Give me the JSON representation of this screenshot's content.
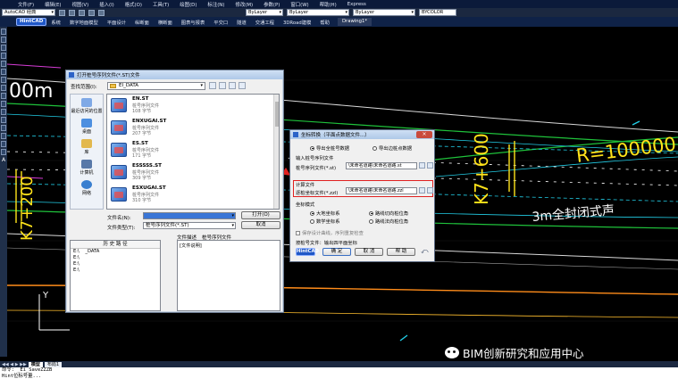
{
  "menubar": [
    "文件(F)",
    "编辑(E)",
    "视图(V)",
    "插入(I)",
    "格式(O)",
    "工具(T)",
    "绘图(D)",
    "标注(N)",
    "修改(M)",
    "参数(P)",
    "窗口(W)",
    "帮助(H)",
    "Express"
  ],
  "workspace": {
    "name": "AutoCAD 经典",
    "layer_label": "ByLayer",
    "linetype_label": "ByLayer",
    "lineweight_label": "ByLayer",
    "plotstyle_label": "BYCOLOR"
  },
  "ribbon": {
    "logo": "HintCAD",
    "items": [
      "系统",
      "数字地面模型",
      "平面设计",
      "纵断面",
      "横断面",
      "图表与报表",
      "平交口",
      "隧道",
      "交通工程",
      "3DRoad建模",
      "帮助"
    ],
    "doc_tab": "Drawing1*"
  },
  "canvas": {
    "labels": {
      "station_left": "K7+200",
      "station_mid": "K7+600",
      "radius": "R=100000",
      "noise_barrier": "3m全封闭式声",
      "partial_left": "00m",
      "ucs_y": "Y"
    }
  },
  "file_dialog": {
    "title": "打开桩号序列文件(*.ST)文件",
    "look_in_label": "查找范围(I):",
    "look_in_value": "EI_DATA",
    "places": [
      "最近访问的位置",
      "桌面",
      "库",
      "计算机",
      "网络"
    ],
    "files": [
      {
        "name": "EN.ST",
        "type": "桩号序列文件",
        "size": "108 字节"
      },
      {
        "name": "ENXUGAI.ST",
        "type": "桩号序列文件",
        "size": "207 字节"
      },
      {
        "name": "ES.ST",
        "type": "桩号序列文件",
        "size": "171 字节"
      },
      {
        "name": "ESSSSS.ST",
        "type": "桩号序列文件",
        "size": "309 字节"
      },
      {
        "name": "ESXUGAI.ST",
        "type": "桩号序列文件",
        "size": "310 字节"
      }
    ],
    "filename_label": "文件名(N):",
    "filename_value": "",
    "filetype_label": "文件类型(T):",
    "filetype_value": "桩号序列文件(*.ST)",
    "open_button": "打开(O)",
    "cancel_button": "取消",
    "history_header": "历 史 路 径",
    "history_rows": [
      "E:\\",
      "E:\\",
      "E:\\",
      "E:\\"
    ],
    "history_suffix": "_DATA",
    "desc_label": "文件描述",
    "desc_value": "桩号序列文件",
    "desc_body": "[文件说明]"
  },
  "transform_dialog": {
    "title": "坐标转换（平面点数据文件...）",
    "mode_options": [
      {
        "label": "导出全桩号数据",
        "selected": true
      },
      {
        "label": "导出边桩点数据",
        "selected": false
      }
    ],
    "input_section": "输入桩号序列文件",
    "input_label": "桩号序列文件(*.st)",
    "input_value": "\\未命名道路\\未命名道路.st",
    "output_section": "计算文件",
    "output_label": "逐桩坐标文件(*.zzl)",
    "output_value": "\\未命名道路\\未命名道路.zzl",
    "coord_section": "坐标模式",
    "coord_options": [
      {
        "label": "大地坐标系",
        "selected": true
      },
      {
        "label": "数学坐标系",
        "selected": false
      },
      {
        "label": "路线切向桩位角",
        "selected": true
      },
      {
        "label": "路线法向桩位角",
        "selected": false
      }
    ],
    "checkbox_label": "保存设计曲线，序列重复检查",
    "footer_label": "按桩号文件：输出四平面坐标",
    "logo": "HintCAD",
    "ok_button": "确 定",
    "cancel_button": "取 消",
    "help_button": "帮 助"
  },
  "bottom": {
    "nav": "◀◀ ◀ ▶ ▶▶",
    "tabs": [
      "模型",
      "布局1"
    ],
    "cmd_lines": [
      "命令: _Ei_SaveZZZB",
      "Hint位标号量..."
    ]
  },
  "watermark": "BIM创新研究和应用中心",
  "colors": {
    "accent": "#1f57c7",
    "highlight": "#e02020",
    "canvas": "#000000"
  }
}
